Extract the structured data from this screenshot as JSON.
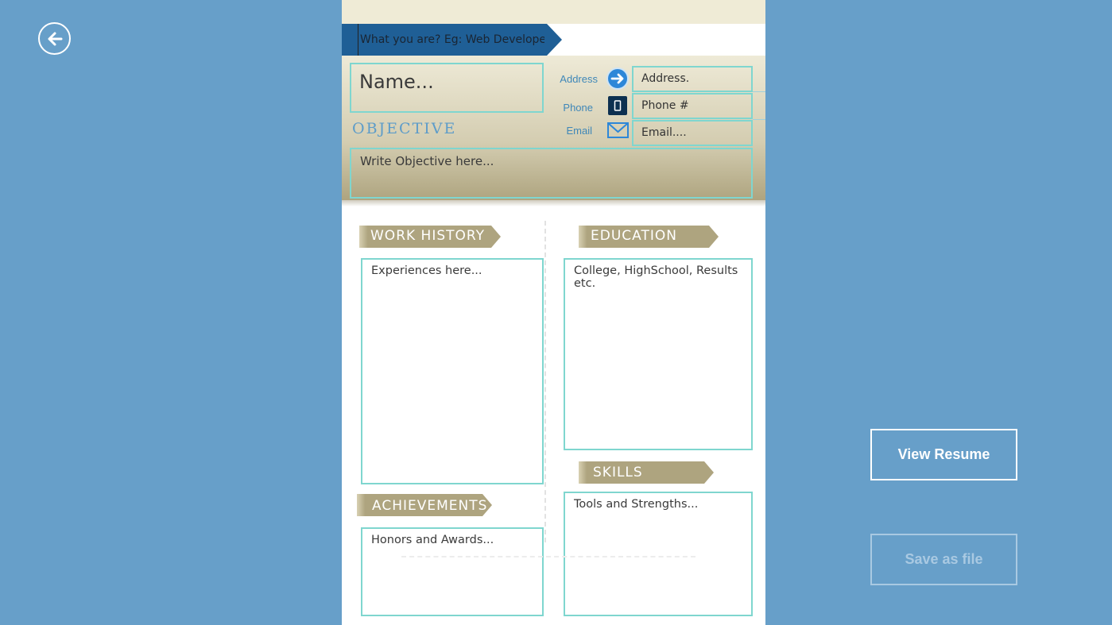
{
  "nav": {
    "back_icon": "back-arrow-icon"
  },
  "resume": {
    "title_placeholder": "What you are? Eg: Web Developer",
    "name_placeholder": "Name...",
    "objective_label": "OBJECTIVE",
    "objective_placeholder": "Write Objective here...",
    "contact": {
      "address_label": "Address",
      "address_placeholder": "Address.",
      "address_icon": "arrow-right-circle-icon",
      "phone_label": "Phone",
      "phone_placeholder": "Phone #",
      "phone_icon": "mobile-phone-icon",
      "email_label": "Email",
      "email_placeholder": "Email....",
      "email_icon": "envelope-icon"
    },
    "sections": {
      "work_history": {
        "title": "WORK HISTORY",
        "placeholder": "Experiences here..."
      },
      "education": {
        "title": "EDUCATION",
        "placeholder": "College, HighSchool, Results etc."
      },
      "achievements": {
        "title": "ACHIEVEMENTS",
        "placeholder": "Honors and Awards..."
      },
      "skills": {
        "title": "SKILLS",
        "placeholder": "Tools and Strengths..."
      }
    }
  },
  "actions": {
    "view_resume": "View Resume",
    "save_as_file": "Save as file"
  },
  "colors": {
    "background": "#679fc9",
    "ribbon_blue": "#1f5f96",
    "section_ribbon": "#aea47f",
    "field_border": "#7fd6cf",
    "label_blue": "#3f87b8"
  }
}
